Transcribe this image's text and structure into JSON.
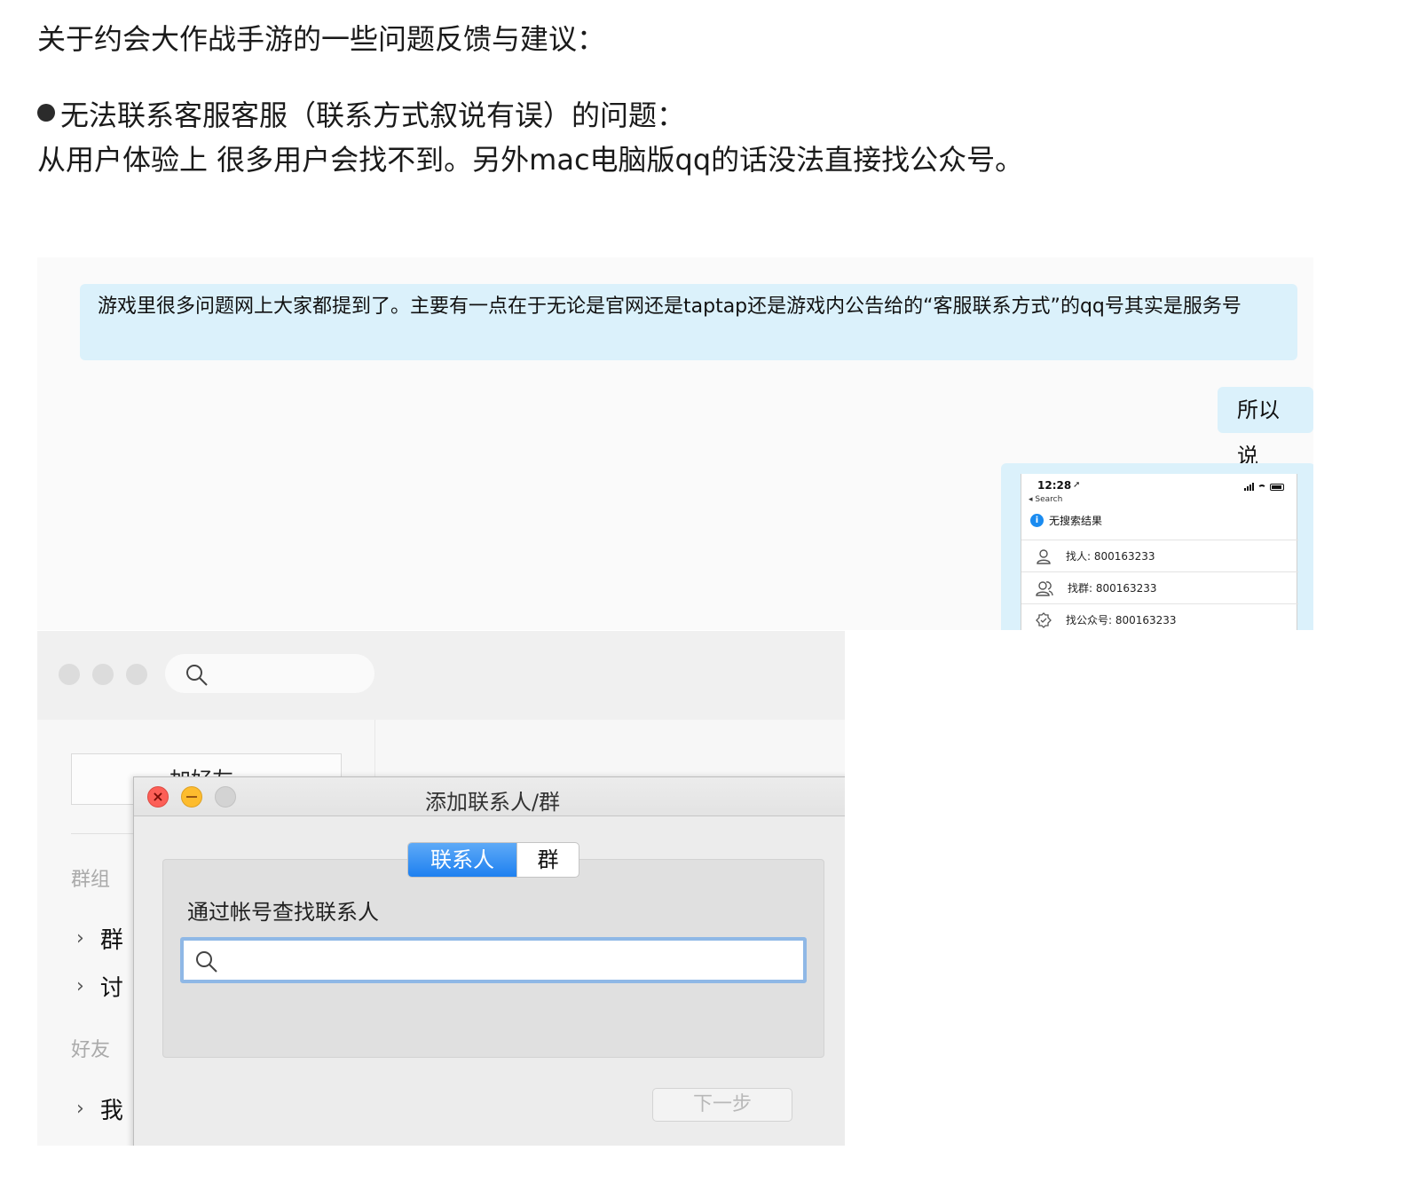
{
  "document": {
    "title": "关于约会大作战手游的一些问题反馈与建议：",
    "bullet": "无法联系客服客服（联系方式叙说有误）的问题：",
    "line": "从用户体验上 很多用户会找不到。另外mac电脑版qq的话没法直接找公众号。"
  },
  "chat": {
    "message_left": "游戏里很多问题网上大家都提到了。主要有一点在于无论是官网还是taptap还是游戏内公告给的“客服联系方式”的qq号其实是服务号",
    "message_right": "所以说",
    "phone": {
      "time": "12:28",
      "back": "◂ Search",
      "no_result": "无搜索结果",
      "rows": [
        {
          "label": "找人:  800163233",
          "icon": "person-icon"
        },
        {
          "label": "找群:  800163233",
          "icon": "group-icon"
        },
        {
          "label": "找公众号:  800163233",
          "icon": "verified-badge-icon"
        }
      ]
    }
  },
  "mac": {
    "sidebar": {
      "add_friend": "加好友",
      "group_header": "群组",
      "group_items": [
        "群",
        "讨"
      ],
      "friends_header": "好友",
      "friend_items": [
        "我"
      ]
    },
    "dialog": {
      "title": "添加联系人/群",
      "tabs": [
        "联系人",
        "群"
      ],
      "selected_tab": "联系人",
      "label": "通过帐号查找联系人",
      "search_value": "",
      "next_button": "下一步"
    }
  },
  "colors": {
    "bubble": "#dbf1fb",
    "segment_active": "#1e80f0",
    "close": "#fc5f57",
    "minimize": "#fdbc2e"
  }
}
